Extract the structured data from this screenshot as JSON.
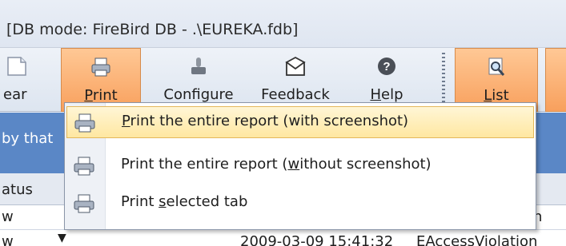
{
  "window": {
    "title": "[DB mode: FireBird DB - .\\EUREKA.fdb]"
  },
  "ribbon": {
    "clear_label": "ear",
    "print": {
      "pre": "",
      "u": "P",
      "post": "rint"
    },
    "configure_label": "Configure",
    "feedback_label": "Feedback",
    "help": {
      "u": "H",
      "post": "elp"
    },
    "list": {
      "u": "L",
      "post": "ist"
    }
  },
  "print_menu": {
    "items": [
      {
        "u": "P",
        "post": "rint the entire report (with screenshot)",
        "highlighted": true
      },
      {
        "pre": "Print the entire report (",
        "u": "w",
        "post": "ithout screenshot)",
        "highlighted": false
      },
      {
        "pre": "Print ",
        "u": "s",
        "post": "elected tab",
        "highlighted": false
      }
    ]
  },
  "background": {
    "group_hint": "by that",
    "column_header": "atus",
    "row1_left": "w",
    "row1_right": "n",
    "row2_left": "w",
    "row2_date": "2009-03-09 15:41:32",
    "row2_exception": "EAccessViolation"
  },
  "colors": {
    "accent_orange": "#f8a05d",
    "band_blue": "#5a87c6",
    "menu_highlight": "#ffe7a1"
  },
  "icons": [
    "document-icon",
    "printer-icon",
    "joystick-icon",
    "envelope-icon",
    "help-icon",
    "magnifier-icon"
  ]
}
